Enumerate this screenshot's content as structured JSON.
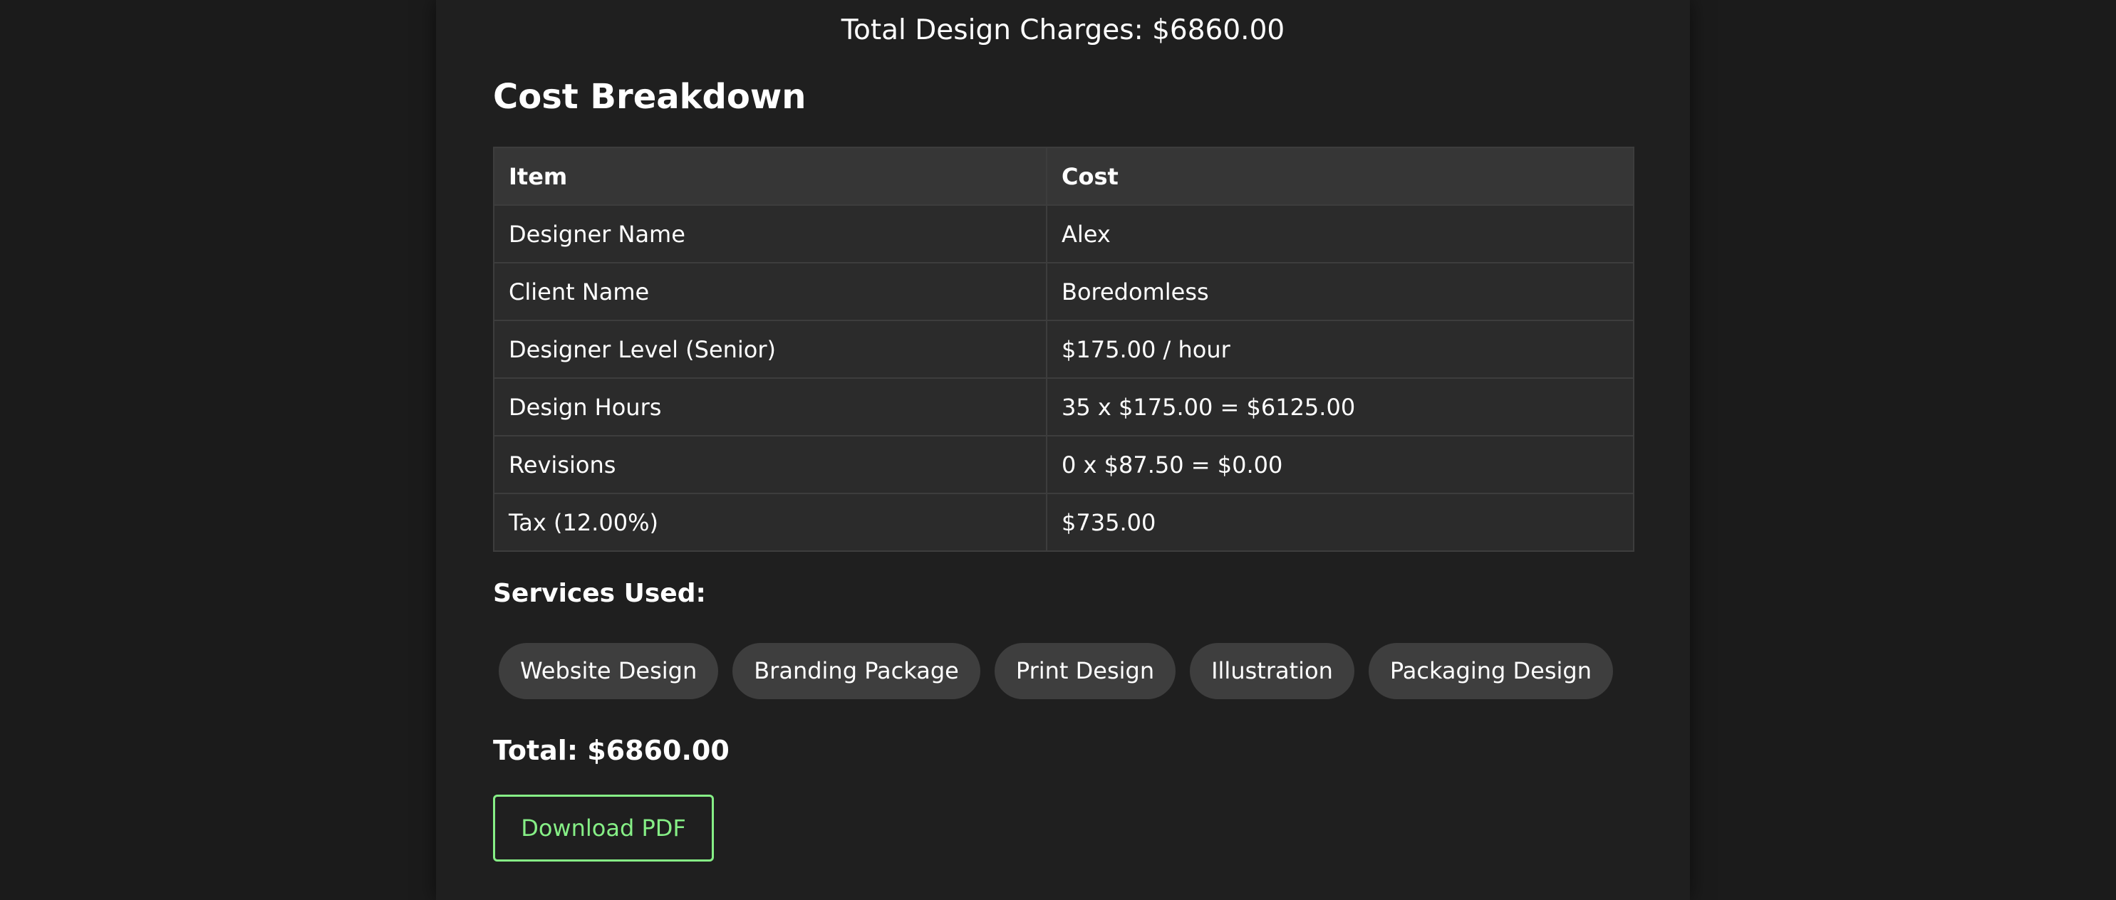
{
  "summary": {
    "total_charges": "Total Design Charges: $6860.00"
  },
  "breakdown": {
    "title": "Cost Breakdown",
    "columns": [
      "Item",
      "Cost"
    ],
    "rows": [
      [
        "Designer Name",
        "Alex"
      ],
      [
        "Client Name",
        "Boredomless"
      ],
      [
        "Designer Level (Senior)",
        "$175.00 / hour"
      ],
      [
        "Design Hours",
        "35 x $175.00 = $6125.00"
      ],
      [
        "Revisions",
        "0 x $87.50 = $0.00"
      ],
      [
        "Tax (12.00%)",
        "$735.00"
      ]
    ]
  },
  "services": {
    "label": "Services Used:",
    "items": [
      "Website Design",
      "Branding Package",
      "Print Design",
      "Illustration",
      "Packaging Design"
    ]
  },
  "total": {
    "text": "Total: $6860.00"
  },
  "actions": {
    "download_label": "Download PDF"
  },
  "colors": {
    "page_background": "#1b1b1b",
    "panel_background": "#1f1f1f",
    "table_header": "#363636",
    "table_cell": "#2b2b2b",
    "pill_background": "#3e3e3e",
    "accent_green": "#86ef86"
  }
}
